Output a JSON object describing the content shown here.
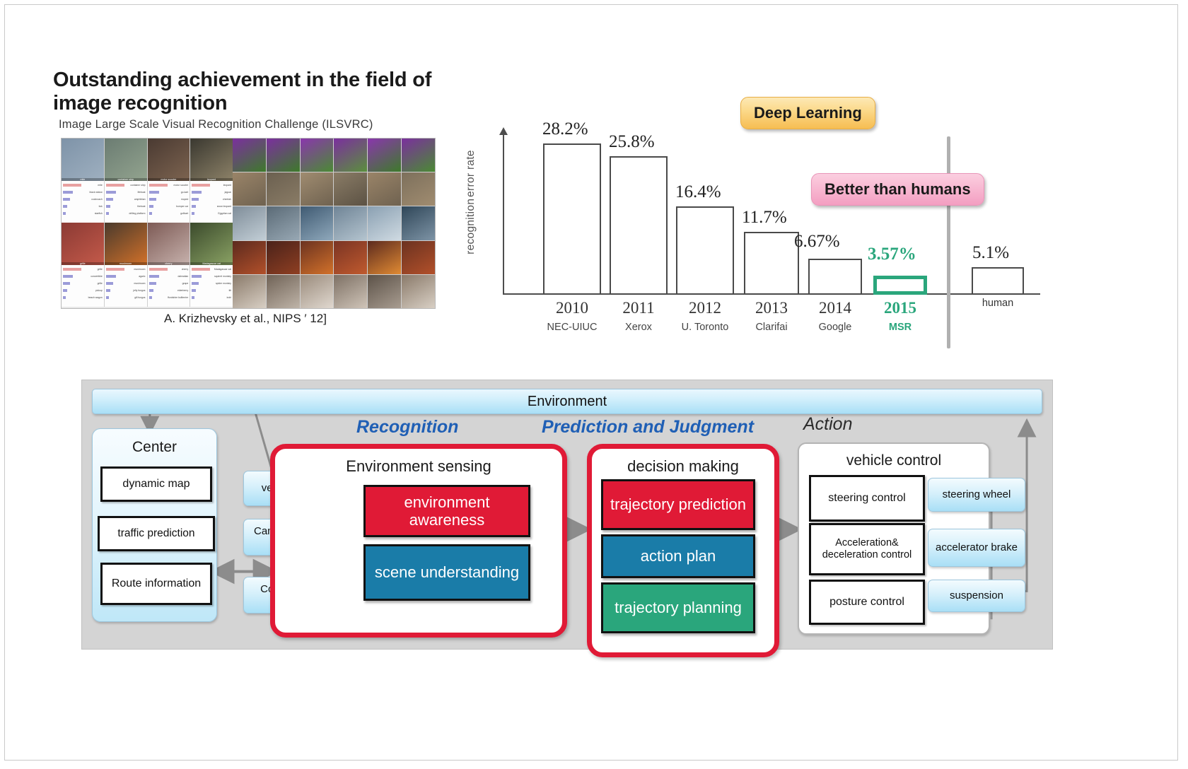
{
  "header": {
    "title": "Outstanding achievement in the field of image recognition",
    "subtitle": "Image Large Scale Visual Recognition Challenge (ILSVRC)",
    "credit": "A. Krizhevsky et al., NIPS ′ 12]"
  },
  "chart_data": {
    "type": "bar",
    "title": "",
    "xlabel": "",
    "ylabel": "recognition error rate",
    "ylabel_lines": [
      "recognition",
      "error rate"
    ],
    "ylim": [
      0,
      30
    ],
    "grid": false,
    "categories": [
      "2010",
      "2011",
      "2012",
      "2013",
      "2014",
      "2015",
      "human"
    ],
    "entrants": [
      "NEC-UIUC",
      "Xerox",
      "U. Toronto",
      "Clarifai",
      "Google",
      "MSR",
      ""
    ],
    "values": [
      28.2,
      25.8,
      16.4,
      11.7,
      6.67,
      3.57,
      5.1
    ],
    "value_labels": [
      "28.2%",
      "25.8%",
      "16.4%",
      "11.7%",
      "6.67%",
      "3.57%",
      "5.1%"
    ],
    "human_label": "human",
    "highlight_index": 5,
    "highlight_color": "#2aa67c",
    "bar_color": "#ffffff",
    "bar_edge_color": "#4a4a4a",
    "annotations": [
      {
        "text": "Deep Learning",
        "target": "2012",
        "fill": "#f6bd52"
      },
      {
        "text": "Better than humans",
        "target": "2015",
        "fill": "#f39ec1"
      }
    ]
  },
  "diagram": {
    "environment_bar": "Environment",
    "phases": {
      "recognition": "Recognition",
      "prediction": "Prediction and Judgment",
      "action": "Action"
    },
    "center": {
      "title": "Center",
      "items": [
        "dynamic map",
        "traffic prediction",
        "Route information"
      ]
    },
    "sensors": [
      "vehicle Sensor",
      "Camera / millimeter wave",
      "Communications Device"
    ],
    "environment_sensing": {
      "title": "Environment sensing",
      "boxes": [
        {
          "label": "environment awareness",
          "color": "#e01a36"
        },
        {
          "label": "scene understanding",
          "color": "#1a7ca8"
        }
      ]
    },
    "decision_making": {
      "title": "decision making",
      "boxes": [
        {
          "label": "trajectory prediction",
          "color": "#e01a36"
        },
        {
          "label": "action plan",
          "color": "#1a7ca8"
        },
        {
          "label": "trajectory planning",
          "color": "#2aa67c"
        }
      ]
    },
    "vehicle_control": {
      "title": "vehicle control",
      "controls": [
        "steering control",
        "Acceleration& deceleration control",
        "posture control"
      ],
      "actuators": [
        "steering wheel",
        "accelerator brake",
        "suspension"
      ]
    }
  }
}
